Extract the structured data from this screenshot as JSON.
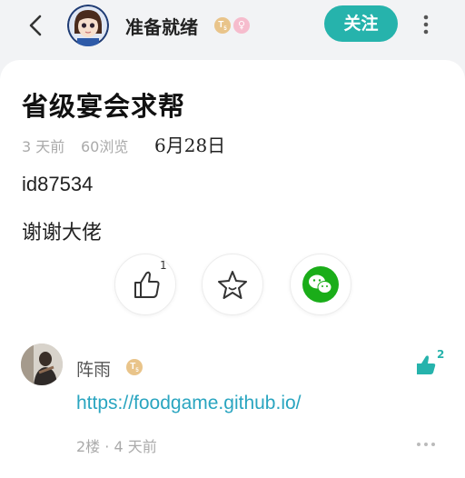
{
  "header": {
    "username": "准备就绪",
    "level_badge": "T",
    "level_sub": "5",
    "gender_icon": "female-icon",
    "follow_label": "关注"
  },
  "post": {
    "title": "省级宴会求帮",
    "age": "3 天前",
    "views": "60浏览",
    "date_note": "6月28日",
    "lines": [
      "id87534",
      "谢谢大佬"
    ],
    "like_count": "1"
  },
  "comment": {
    "username": "阵雨",
    "level_badge": "T",
    "level_sub": "5",
    "link": "https://foodgame.github.io/",
    "meta": "2楼 · 4 天前",
    "like_count": "2"
  },
  "colors": {
    "accent": "#26b3ac",
    "wechat": "#1aad19",
    "link": "#2aa5c0"
  }
}
